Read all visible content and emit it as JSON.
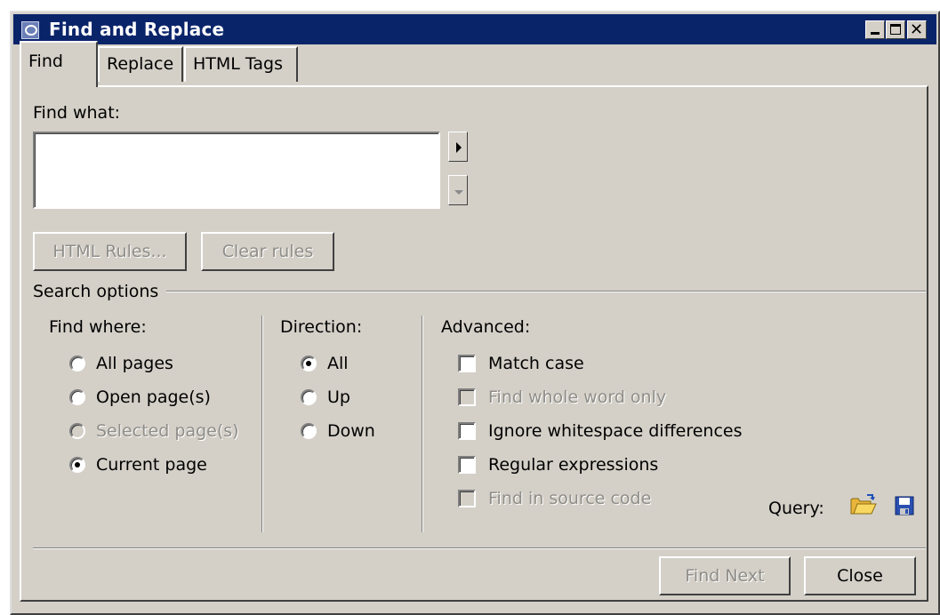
{
  "window": {
    "title": "Find and Replace"
  },
  "tabs": [
    {
      "label": "Find",
      "active": true
    },
    {
      "label": "Replace",
      "active": false
    },
    {
      "label": "HTML Tags",
      "active": false
    }
  ],
  "find": {
    "label": "Find what:",
    "value": "",
    "html_rules_label": "HTML Rules...",
    "clear_rules_label": "Clear rules"
  },
  "search_options": {
    "title": "Search options",
    "find_where": {
      "label": "Find where:",
      "options": [
        {
          "label": "All pages",
          "checked": false,
          "enabled": true
        },
        {
          "label": "Open page(s)",
          "checked": false,
          "enabled": true
        },
        {
          "label": "Selected page(s)",
          "checked": false,
          "enabled": false
        },
        {
          "label": "Current page",
          "checked": true,
          "enabled": true
        }
      ]
    },
    "direction": {
      "label": "Direction:",
      "options": [
        {
          "label": "All",
          "checked": true
        },
        {
          "label": "Up",
          "checked": false
        },
        {
          "label": "Down",
          "checked": false
        }
      ]
    },
    "advanced": {
      "label": "Advanced:",
      "options": [
        {
          "label": "Match case",
          "checked": false,
          "enabled": true
        },
        {
          "label": "Find whole word only",
          "checked": false,
          "enabled": false
        },
        {
          "label": "Ignore whitespace differences",
          "checked": false,
          "enabled": true
        },
        {
          "label": "Regular expressions",
          "checked": false,
          "enabled": true
        },
        {
          "label": "Find in source code",
          "checked": false,
          "enabled": false
        }
      ]
    },
    "query_label": "Query:"
  },
  "footer": {
    "find_next_label": "Find Next",
    "close_label": "Close"
  },
  "colors": {
    "titlebar": "#0a246a",
    "face": "#d4d0c8",
    "disabled_text": "#8f8d88"
  }
}
